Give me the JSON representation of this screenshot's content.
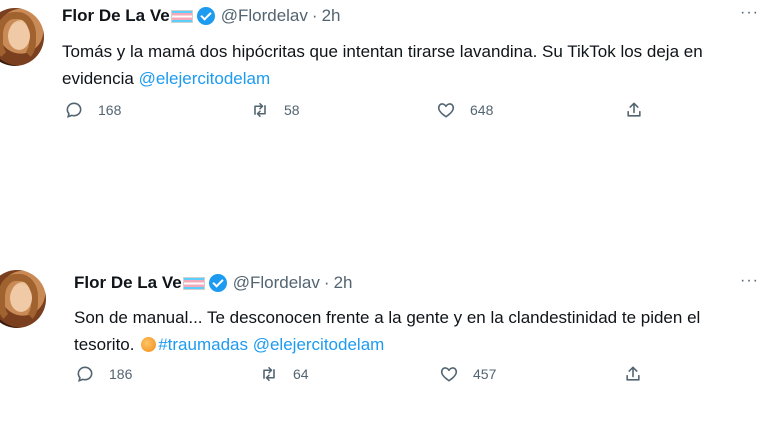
{
  "tweets": [
    {
      "name": "Flor De La Ve",
      "handle": "@Flordelav",
      "dot": "·",
      "time": "2h",
      "more": "···",
      "text_before": "Tomás y la mamá dos hipócritas que intentan tirarse lavandina. Su TikTok los deja en evidencia ",
      "hashtag": "",
      "mention": "@elejercitodelam",
      "replies": "168",
      "retweets": "58",
      "likes": "648"
    },
    {
      "name": "Flor De La Ve",
      "handle": "@Flordelav",
      "dot": "·",
      "time": "2h",
      "more": "···",
      "text_before": "Son de manual... Te desconocen frente a la gente y en la clandestinidad te piden el tesorito. ",
      "hashtag": "#traumadas",
      "mention": "@elejercitodelam",
      "replies": "186",
      "retweets": "64",
      "likes": "457"
    }
  ],
  "icons": {
    "verified": "verified-badge-icon",
    "flag": "transgender-flag-icon",
    "reply": "reply-icon",
    "retweet": "retweet-icon",
    "like": "heart-icon",
    "share": "share-icon",
    "emoji": "peach-emoji-icon"
  },
  "colors": {
    "link": "#1d9bf0",
    "muted": "#536471",
    "text": "#0f1419"
  }
}
